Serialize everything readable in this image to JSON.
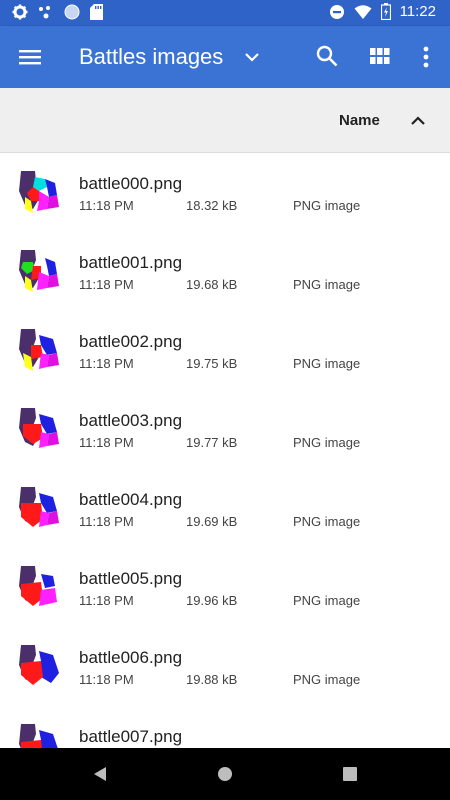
{
  "status_bar": {
    "time": "11:22",
    "icons_left": [
      "gear-icon",
      "dots-icon",
      "circle-icon",
      "sd-card-icon"
    ],
    "icons_right": [
      "dnd-icon",
      "wifi-icon",
      "battery-icon"
    ]
  },
  "app_bar": {
    "title": "Battles images",
    "icons": [
      "menu-icon",
      "dropdown-icon",
      "search-icon",
      "grid-view-icon",
      "more-icon"
    ],
    "color": "#3b73d5"
  },
  "sort": {
    "label": "Name",
    "direction": "ascending"
  },
  "files": [
    {
      "name": "battle000.png",
      "time": "11:18 PM",
      "size": "18.32 kB",
      "type": "PNG image"
    },
    {
      "name": "battle001.png",
      "time": "11:18 PM",
      "size": "19.68 kB",
      "type": "PNG image"
    },
    {
      "name": "battle002.png",
      "time": "11:18 PM",
      "size": "19.75 kB",
      "type": "PNG image"
    },
    {
      "name": "battle003.png",
      "time": "11:18 PM",
      "size": "19.77 kB",
      "type": "PNG image"
    },
    {
      "name": "battle004.png",
      "time": "11:18 PM",
      "size": "19.69 kB",
      "type": "PNG image"
    },
    {
      "name": "battle005.png",
      "time": "11:18 PM",
      "size": "19.96 kB",
      "type": "PNG image"
    },
    {
      "name": "battle006.png",
      "time": "11:18 PM",
      "size": "19.88 kB",
      "type": "PNG image"
    },
    {
      "name": "battle007.png",
      "time": "",
      "size": "",
      "type": ""
    }
  ],
  "nav_bar": {
    "icons": [
      "back-icon",
      "home-icon",
      "recents-icon"
    ]
  }
}
